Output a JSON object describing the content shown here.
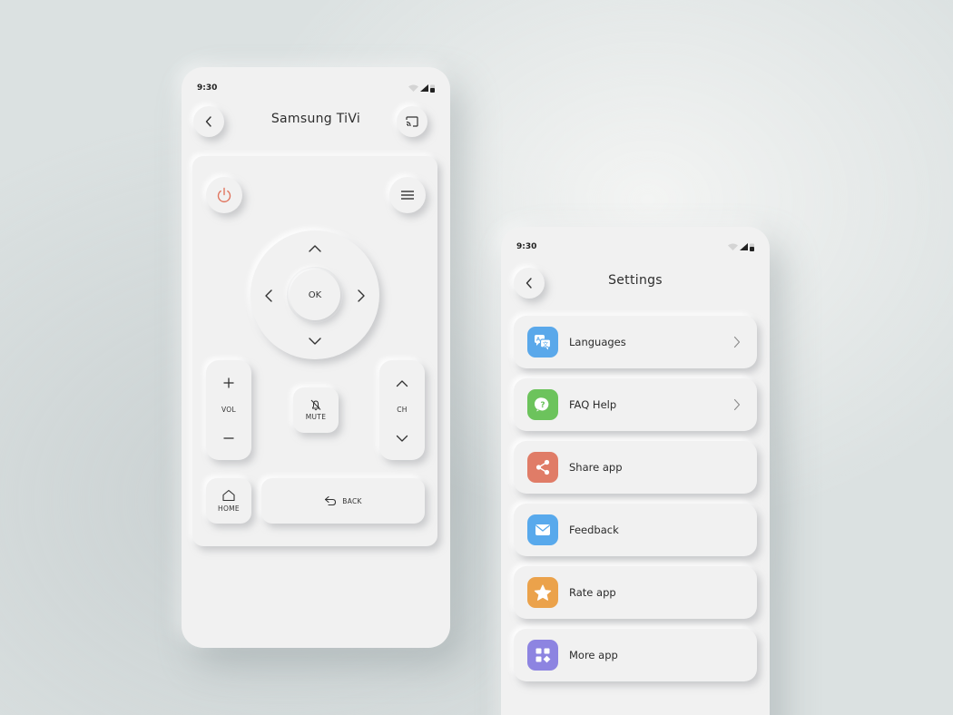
{
  "remote_screen": {
    "status_time": "9:30",
    "title": "Samsung TiVi",
    "ok_label": "OK",
    "vol_label": "VOL",
    "mute_label": "MUTE",
    "ch_label": "CH",
    "home_label": "HOME",
    "back_label": "BACK",
    "power_color": "#e0755f"
  },
  "settings_screen": {
    "status_time": "9:30",
    "title": "Settings",
    "items": [
      {
        "label": "Languages",
        "icon": "translate-icon",
        "color": "#5aa8ea",
        "has_chevron": true
      },
      {
        "label": "FAQ Help",
        "icon": "help-chat-icon",
        "color": "#6cc35c",
        "has_chevron": true
      },
      {
        "label": "Share app",
        "icon": "share-icon",
        "color": "#e07c67",
        "has_chevron": false
      },
      {
        "label": "Feedback",
        "icon": "mail-icon",
        "color": "#58a9ec",
        "has_chevron": false
      },
      {
        "label": "Rate app",
        "icon": "star-icon",
        "color": "#eba24b",
        "has_chevron": false
      },
      {
        "label": "More app",
        "icon": "apps-grid-icon",
        "color": "#8d84e1",
        "has_chevron": false
      }
    ]
  }
}
